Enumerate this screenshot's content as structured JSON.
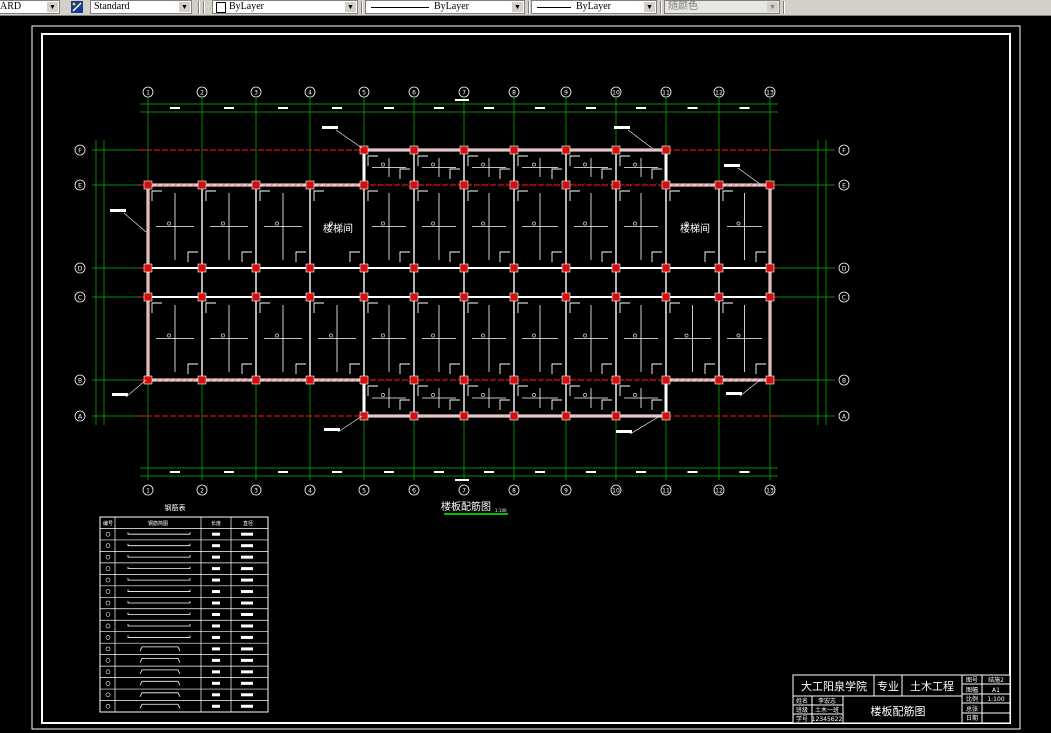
{
  "toolbar": {
    "textstyle_partial": "ARD",
    "dimstyle": "Standard",
    "layer": "ByLayer",
    "linetype": "ByLayer",
    "lineweight": "ByLayer",
    "plotstyle": "随颜色"
  },
  "drawing": {
    "axis_numbers": [
      "1",
      "2",
      "3",
      "4",
      "5",
      "6",
      "7",
      "8",
      "9",
      "10",
      "11",
      "12",
      "13"
    ],
    "axis_letters_top_to_bottom": [
      "F",
      "E",
      "D",
      "C",
      "B",
      "A"
    ],
    "room_labels": [
      "楼梯间",
      "楼梯间"
    ],
    "main_title": "楼板配筋图",
    "main_scale": "1:100",
    "table": {
      "title": "钢筋表",
      "headers": [
        "编号",
        "钢筋简图",
        "长度",
        "直径"
      ],
      "row_count": 16
    },
    "title_block": {
      "school": "大工阳泉学院",
      "major_label": "专业",
      "major": "土木工程",
      "drawing_name": "楼板配筋图",
      "rows_left": [
        "姓名",
        "班级",
        "学号"
      ],
      "rows_left_values": [
        "李宏志",
        "土木一班",
        "12345622"
      ],
      "rows_right": [
        "图号",
        "图幅",
        "比例",
        "总张",
        "日期"
      ],
      "rows_right_values": [
        "结施2",
        "A1",
        "1:100",
        "",
        ""
      ]
    }
  },
  "colors": {
    "background": "#000000",
    "axis_green": "#00c000",
    "wall_white": "#ffffff",
    "beam_red": "#d01010",
    "toolbar": "#d4d0c8"
  }
}
